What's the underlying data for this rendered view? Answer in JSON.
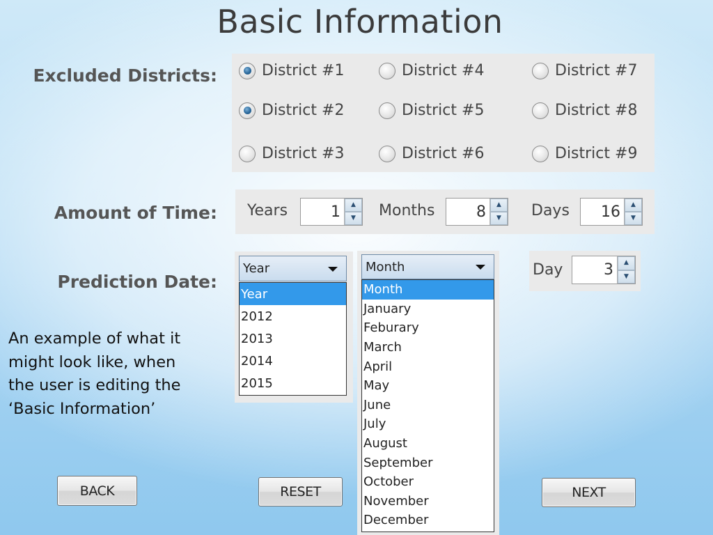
{
  "title": "Basic Information",
  "labels": {
    "excluded_districts": "Excluded Districts:",
    "amount_of_time": "Amount of Time:",
    "prediction_date": "Prediction Date:"
  },
  "districts": [
    {
      "label": "District #1",
      "checked": true
    },
    {
      "label": "District #2",
      "checked": true
    },
    {
      "label": "District #3",
      "checked": false
    },
    {
      "label": "District #4",
      "checked": false
    },
    {
      "label": "District #5",
      "checked": false
    },
    {
      "label": "District #6",
      "checked": false
    },
    {
      "label": "District #7",
      "checked": false
    },
    {
      "label": "District #8",
      "checked": false
    },
    {
      "label": "District #9",
      "checked": false
    }
  ],
  "amount_of_time": {
    "years_label": "Years",
    "years_value": "1",
    "months_label": "Months",
    "months_value": "8",
    "days_label": "Days",
    "days_value": "16"
  },
  "prediction_date": {
    "year_selected": "Year",
    "year_options": [
      "Year",
      "2012",
      "2013",
      "2014",
      "2015"
    ],
    "month_selected": "Month",
    "month_options": [
      "Month",
      "January",
      "Feburary",
      "March",
      "April",
      "May",
      "June",
      "July",
      "August",
      "September",
      "October",
      "November",
      "December"
    ],
    "day_label": "Day",
    "day_value": "3"
  },
  "description": "An example of what it might look like, when the user is editing the ‘Basic Information’",
  "buttons": {
    "back": "BACK",
    "reset": "RESET",
    "next": "NEXT"
  },
  "colors": {
    "selected_option": "#3399ea",
    "radio_checked": "#2c6a9d"
  }
}
